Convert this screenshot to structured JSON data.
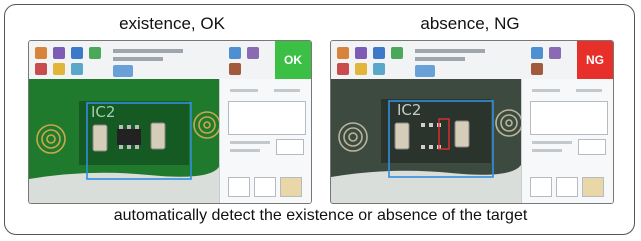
{
  "panels": [
    {
      "title": "existence, OK",
      "status_label": "OK",
      "status_color": "#3bbf45",
      "chip_label": "IC2",
      "component_present": true
    },
    {
      "title": "absence, NG",
      "status_label": "NG",
      "status_color": "#e8302a",
      "chip_label": "IC2",
      "component_present": false
    }
  ],
  "caption": "automatically detect the existence or absence of the target",
  "colors": {
    "pcb_green": "#1f7a2e",
    "inspection_box": "#2f8fe0",
    "defect_box": "#e03030"
  }
}
